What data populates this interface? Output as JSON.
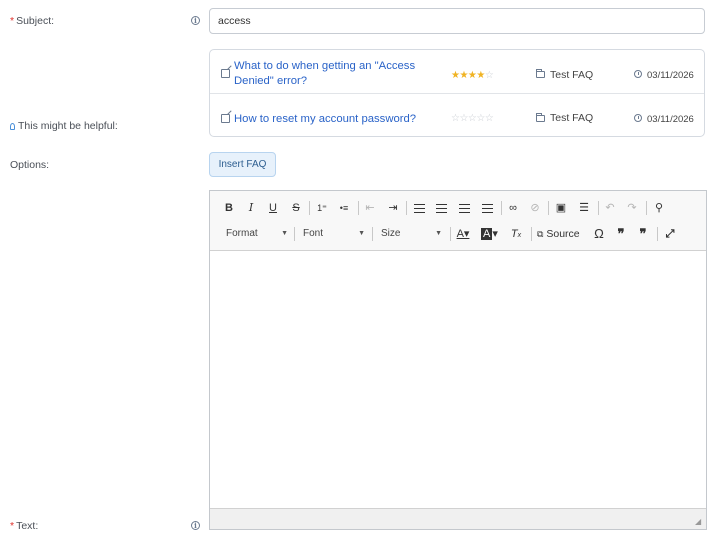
{
  "subject": {
    "required_mark": "*",
    "label": "Subject:",
    "value": "access"
  },
  "suggestions": {
    "label": "This might be helpful:",
    "items": [
      {
        "title": "What to do when getting an \"Access Denied\" error?",
        "rating": 4,
        "max_rating": 5,
        "category": "Test FAQ",
        "date": "03/11/2026"
      },
      {
        "title": "How to reset my account password?",
        "rating": 0,
        "max_rating": 5,
        "category": "Test FAQ",
        "date": "03/11/2026"
      }
    ]
  },
  "options": {
    "label": "Options:",
    "insert_faq_label": "Insert FAQ"
  },
  "editor": {
    "format_label": "Format",
    "font_label": "Font",
    "size_label": "Size",
    "source_label": "Source"
  },
  "text_field": {
    "required_mark": "*",
    "label": "Text:"
  },
  "colors": {
    "link": "#2a63c8",
    "required": "#e0302b",
    "star": "#f0b323",
    "insert_button_bg": "#e7f1fb"
  }
}
